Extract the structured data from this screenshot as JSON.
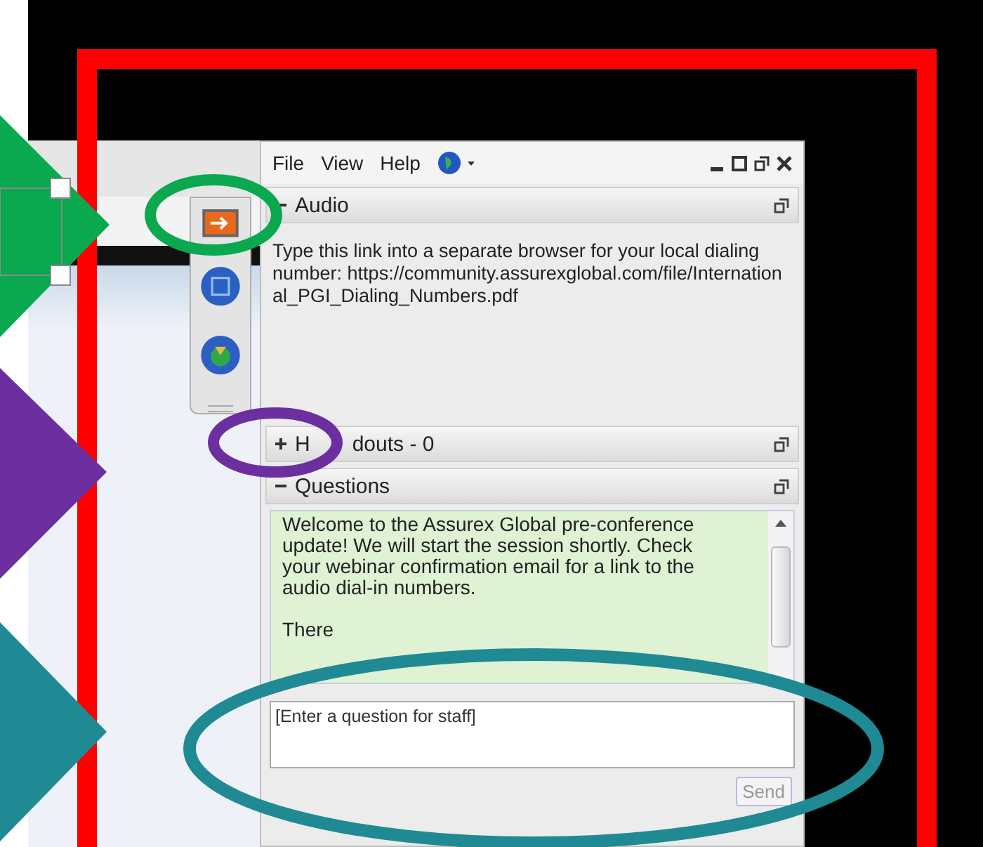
{
  "panel": {
    "menu": [
      {
        "label": "File"
      },
      {
        "label": "View"
      },
      {
        "label": "Help"
      }
    ],
    "sections": [
      {
        "kind": "audio",
        "title_parts": [
          "Audio"
        ],
        "expanded": true,
        "text": "Type this link into a separate browser for your local dialing number:",
        "link": "https://community.assurexglobal.com/file/International_PGI_Dialing_Numbers.pdf"
      },
      {
        "kind": "handouts",
        "title_parts": [
          "H",
          "douts - 0"
        ],
        "expanded": false
      },
      {
        "kind": "questions",
        "title_parts": [
          "Questions"
        ],
        "expanded": true,
        "messages": [
          "Welcome to the Assurex Global pre-conference update! We will start the session shortly. Check your webinar confirmation email for a link to the audio dial-in numbers.",
          "There"
        ],
        "input": {
          "placeholder": "[Enter a question for staff]"
        },
        "send": "Send"
      }
    ]
  }
}
